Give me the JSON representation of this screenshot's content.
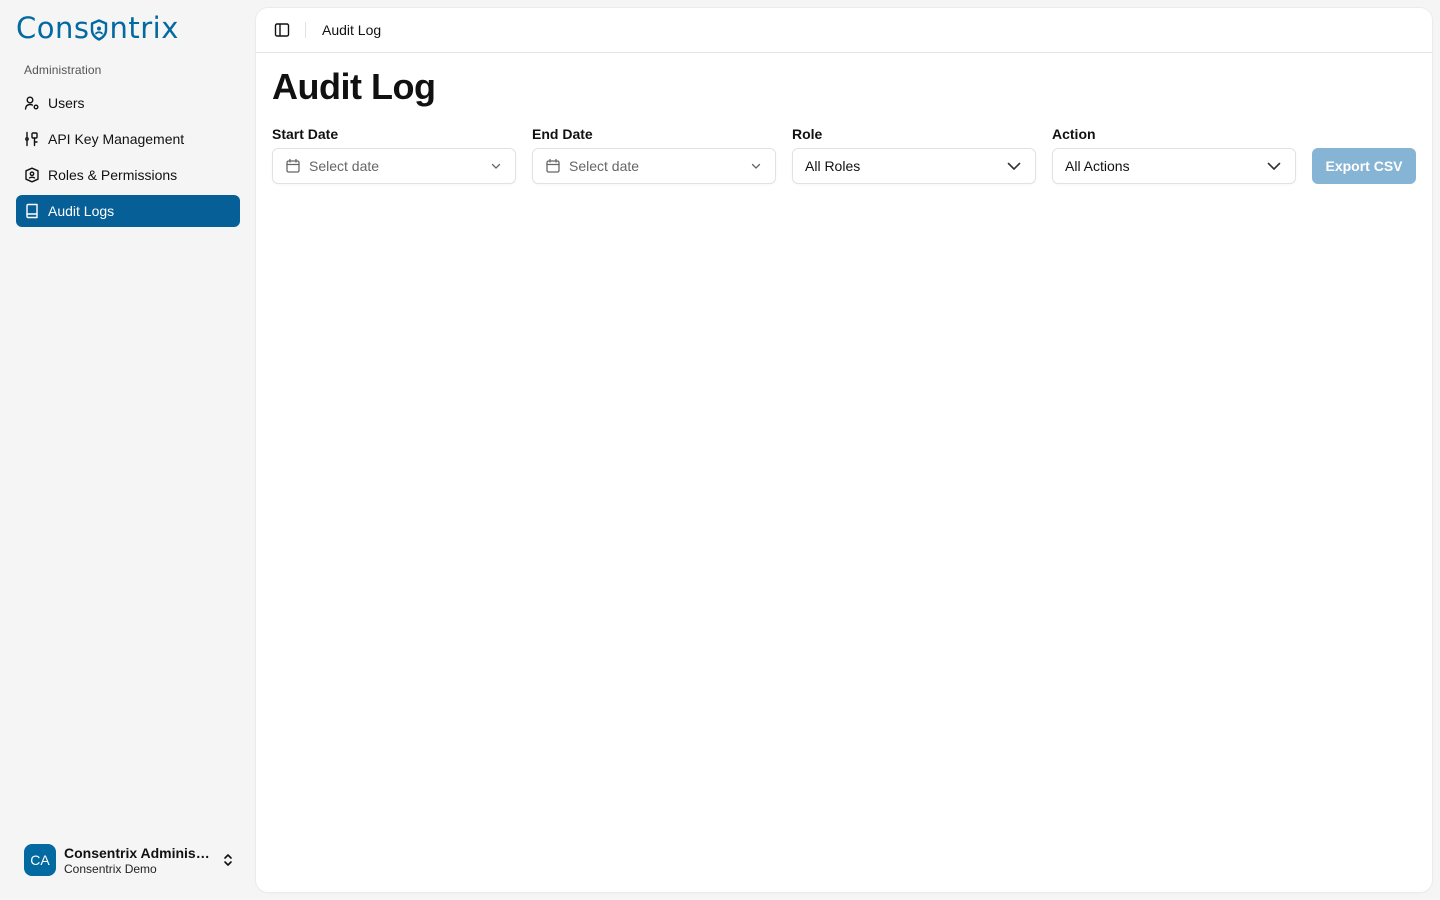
{
  "brand": {
    "name_prefix": "Cons",
    "name_suffix": "ntrix",
    "color": "#0369a1"
  },
  "sidebar": {
    "section_label": "Administration",
    "items": [
      {
        "label": "Users",
        "icon": "user-cog-icon",
        "active": false
      },
      {
        "label": "API Key Management",
        "icon": "key-icon",
        "active": false
      },
      {
        "label": "Roles & Permissions",
        "icon": "shield-icon",
        "active": false
      },
      {
        "label": "Audit Logs",
        "icon": "book-icon",
        "active": true
      }
    ],
    "active_color": "#075f97"
  },
  "user": {
    "initials": "CA",
    "name": "Consentrix Administrator",
    "org": "Consentrix Demo"
  },
  "topbar": {
    "title": "Audit Log"
  },
  "page": {
    "title": "Audit Log"
  },
  "filters": {
    "start_date": {
      "label": "Start Date",
      "placeholder": "Select date"
    },
    "end_date": {
      "label": "End Date",
      "placeholder": "Select date"
    },
    "role": {
      "label": "Role",
      "value": "All Roles"
    },
    "action": {
      "label": "Action",
      "value": "All Actions"
    },
    "export_label": "Export CSV",
    "export_color": "#86b4d4"
  }
}
